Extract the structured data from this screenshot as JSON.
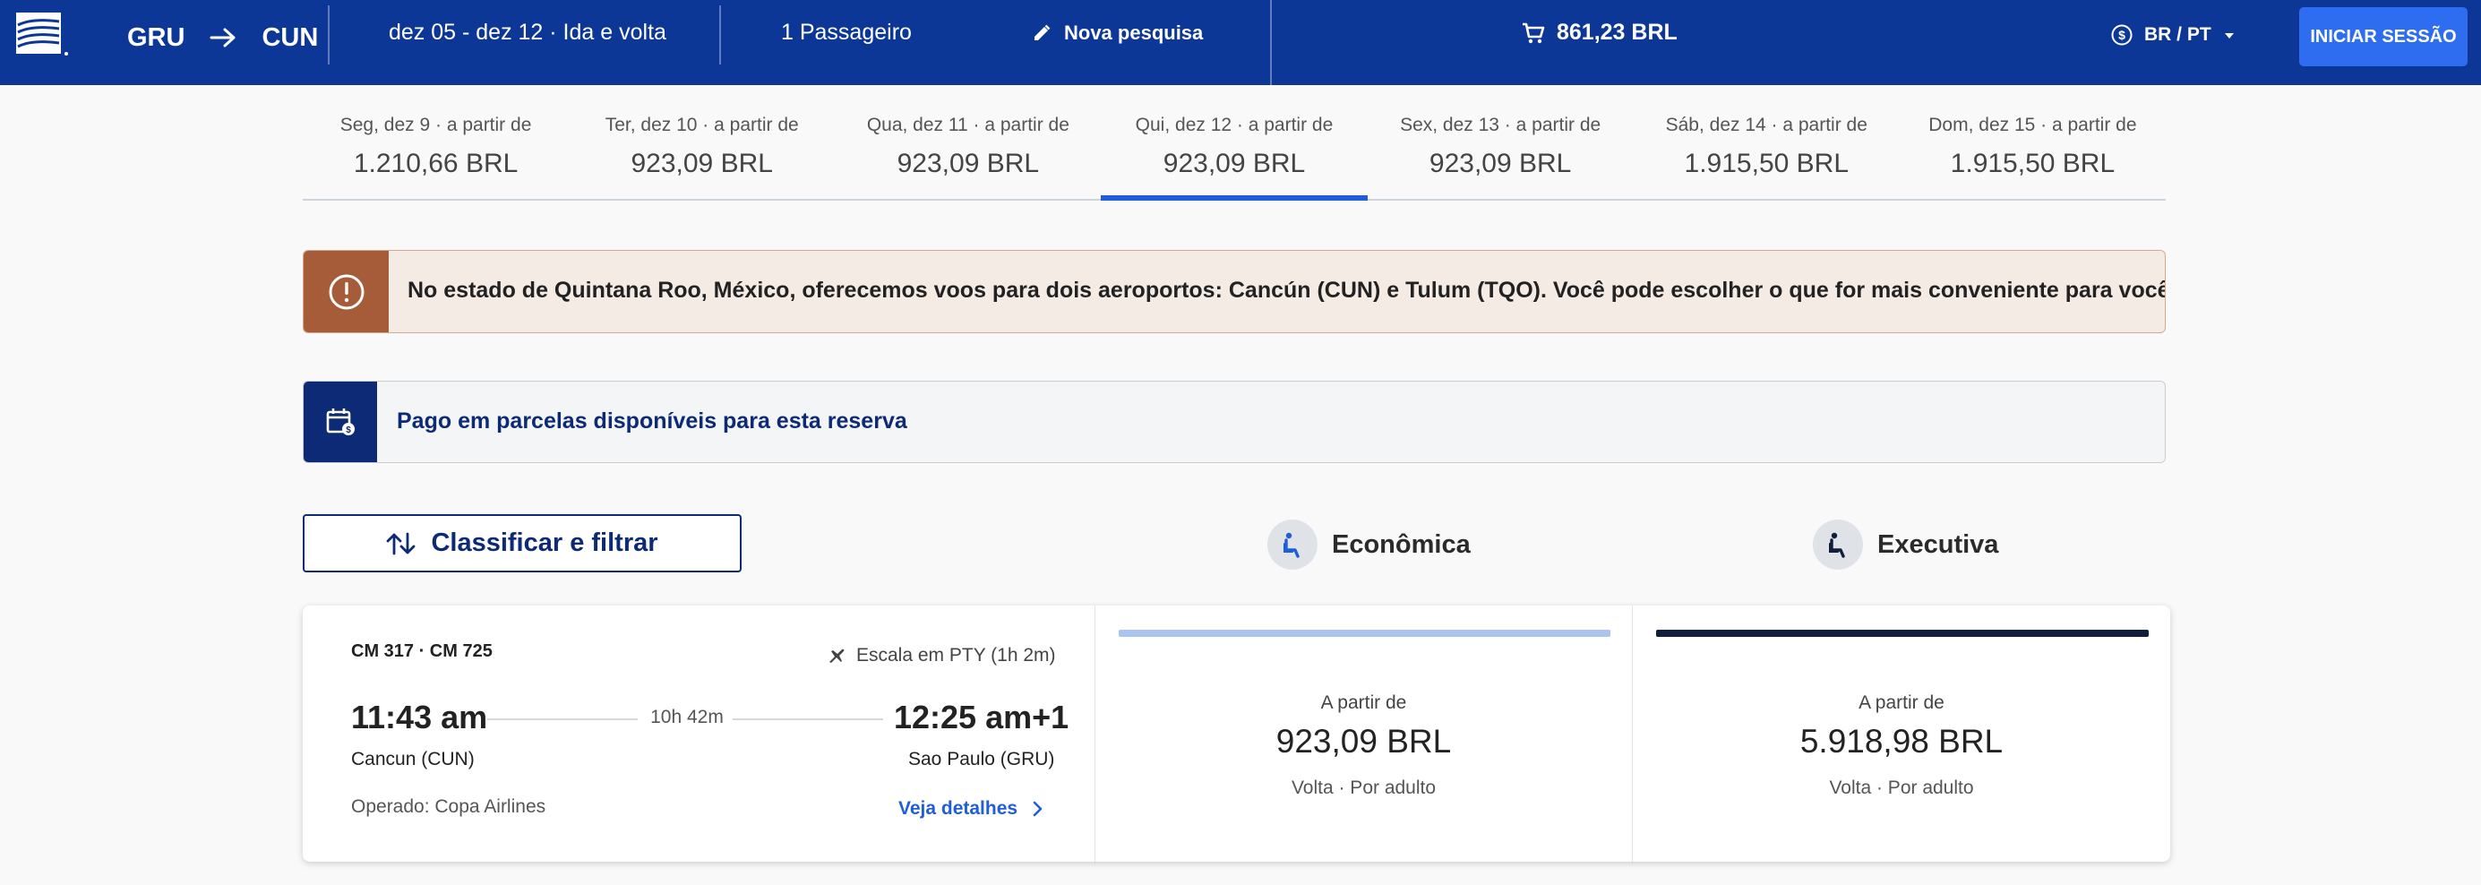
{
  "header": {
    "origin": "GRU",
    "destination": "CUN",
    "dates": "dez 05 - dez 12 · Ida e volta",
    "passengers": "1 Passageiro",
    "new_search": "Nova pesquisa",
    "cart_total": "861,23 BRL",
    "locale": "BR / PT",
    "login": "INICIAR SESSÃO"
  },
  "date_tabs": [
    {
      "label": "Seg, dez 9 · a partir de",
      "price": "1.210,66 BRL"
    },
    {
      "label": "Ter, dez 10 · a partir de",
      "price": "923,09 BRL"
    },
    {
      "label": "Qua, dez 11 · a partir de",
      "price": "923,09 BRL"
    },
    {
      "label": "Qui, dez 12 · a partir de",
      "price": "923,09 BRL"
    },
    {
      "label": "Sex, dez 13 · a partir de",
      "price": "923,09 BRL"
    },
    {
      "label": "Sáb, dez 14 · a partir de",
      "price": "1.915,50 BRL"
    },
    {
      "label": "Dom, dez 15 · a partir de",
      "price": "1.915,50 BRL"
    }
  ],
  "alerts": {
    "airport_notice": "No estado de Quintana Roo, México, oferecemos voos para dois aeroportos: Cancún (CUN) e Tulum (TQO). Você pode escolher o que for mais conveniente para você.",
    "installments": "Pago em parcelas disponíveis para esta reserva"
  },
  "sort_filter": "Classificar e filtrar",
  "cabins": {
    "economy": "Econômica",
    "business": "Executiva"
  },
  "flight": {
    "numbers": "CM 317 · CM 725",
    "stop": "Escala em PTY (1h 2m)",
    "depart_time": "11:43 am",
    "arrive_time": "12:25 am+1",
    "duration": "10h 42m",
    "depart_city": "Cancun (CUN)",
    "arrive_city": "Sao Paulo (GRU)",
    "operator": "Operado: Copa Airlines",
    "details": "Veja detalhes",
    "fares": [
      {
        "from": "A partir de",
        "price": "923,09 BRL",
        "note": "Volta · Por adulto"
      },
      {
        "from": "A partir de",
        "price": "5.918,98 BRL",
        "note": "Volta · Por adulto"
      }
    ]
  },
  "colors": {
    "header_bg": "#0c3796",
    "primary": "#1f5ed8",
    "warning": "#a65c39",
    "info": "#0c2a75"
  }
}
